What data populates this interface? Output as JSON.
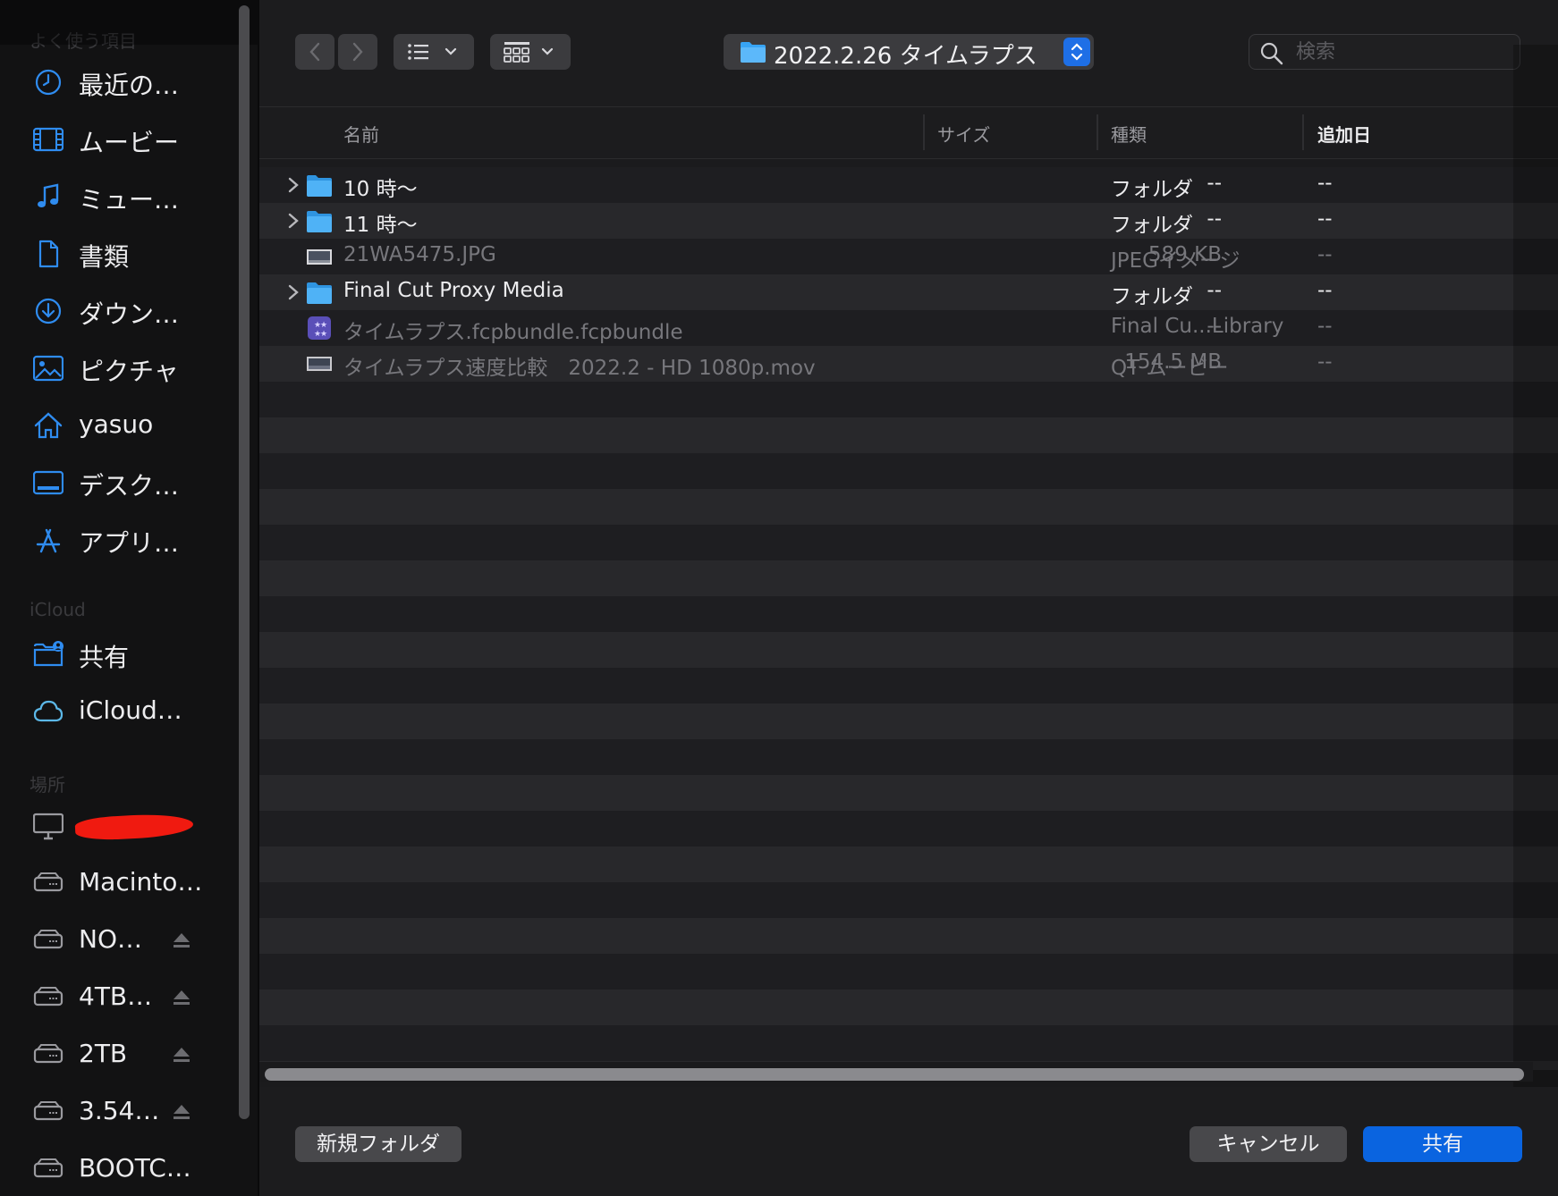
{
  "sidebar": {
    "favorites_header": "よく使う項目",
    "favorites": [
      {
        "label": "最近の…",
        "icon": "clock-icon"
      },
      {
        "label": "ムービー",
        "icon": "film-icon"
      },
      {
        "label": "ミュー…",
        "icon": "music-note-icon"
      },
      {
        "label": "書類",
        "icon": "document-icon"
      },
      {
        "label": "ダウン…",
        "icon": "download-icon"
      },
      {
        "label": "ピクチャ",
        "icon": "picture-icon"
      },
      {
        "label": "yasuo",
        "icon": "home-icon"
      },
      {
        "label": "デスク…",
        "icon": "desktop-icon"
      },
      {
        "label": "アプリ…",
        "icon": "applications-icon"
      }
    ],
    "icloud_header": "iCloud",
    "icloud": [
      {
        "label": "共有",
        "icon": "shared-folder-icon"
      },
      {
        "label": "iCloud…",
        "icon": "cloud-icon"
      }
    ],
    "locations_header": "場所",
    "locations": [
      {
        "label": "",
        "icon": "computer-icon",
        "redacted": true
      },
      {
        "label": "Macinto…",
        "icon": "drive-icon",
        "eject": false
      },
      {
        "label": "NO…",
        "icon": "drive-icon",
        "eject": true
      },
      {
        "label": "4TB…",
        "icon": "drive-icon",
        "eject": true
      },
      {
        "label": "2TB",
        "icon": "drive-icon",
        "eject": true
      },
      {
        "label": "3.54…",
        "icon": "drive-icon",
        "eject": true
      },
      {
        "label": "BOOTC…",
        "icon": "drive-icon",
        "eject": false
      }
    ]
  },
  "toolbar": {
    "path": "2022.2.26 タイムラプス",
    "search_placeholder": "検索"
  },
  "columns": {
    "name": "名前",
    "size": "サイズ",
    "kind": "種類",
    "date_added": "追加日"
  },
  "files": [
    {
      "name": "10 時〜",
      "size": "--",
      "kind": "フォルダ",
      "date": "--",
      "type": "folder",
      "enabled": true,
      "disclosure": true
    },
    {
      "name": "11 時〜",
      "size": "--",
      "kind": "フォルダ",
      "date": "--",
      "type": "folder",
      "enabled": true,
      "disclosure": true
    },
    {
      "name": "21WA5475.JPG",
      "size": "589 KB",
      "kind": "JPEGイメージ",
      "date": "--",
      "type": "image",
      "enabled": false,
      "disclosure": false
    },
    {
      "name": "Final Cut Proxy Media",
      "size": "--",
      "kind": "フォルダ",
      "date": "--",
      "type": "folder",
      "enabled": true,
      "disclosure": true
    },
    {
      "name": "タイムラプス.fcpbundle.fcpbundle",
      "size": "--",
      "kind": "Final Cu...Library",
      "date": "--",
      "type": "library",
      "enabled": false,
      "disclosure": false
    },
    {
      "name": "タイムラプス速度比較　2022.2 - HD 1080p.mov",
      "size": "154.5 MB",
      "kind": "QT ムービー",
      "date": "--",
      "type": "movie",
      "enabled": false,
      "disclosure": false
    }
  ],
  "buttons": {
    "new_folder": "新規フォルダ",
    "cancel": "キャンセル",
    "share": "共有"
  },
  "colors": {
    "accent": "#1e6fe6",
    "sidebar_icon": "#2f8cf0",
    "folder": "#37a4f5",
    "primary_button": "#0a64e0"
  }
}
